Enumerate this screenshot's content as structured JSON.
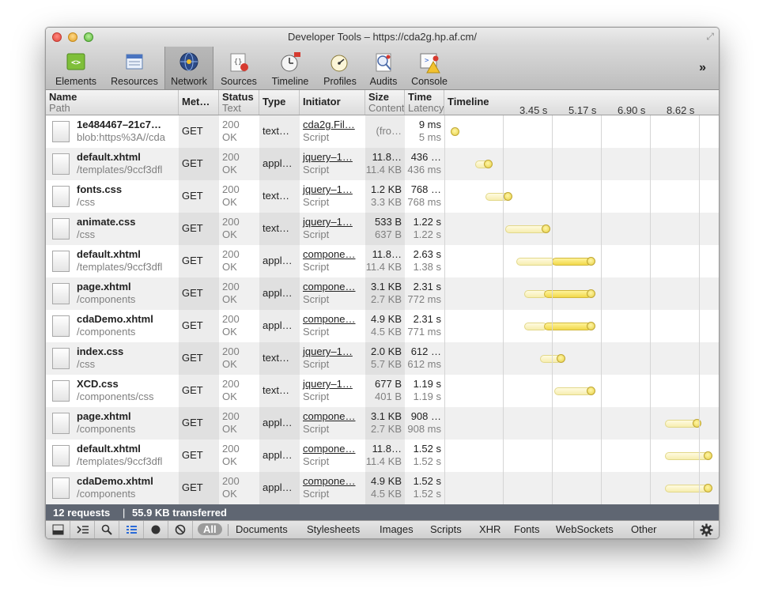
{
  "window": {
    "title": "Developer Tools – https://cda2g.hp.af.cm/"
  },
  "toolbar": {
    "items": [
      {
        "label": "Elements",
        "icon": "elements-icon"
      },
      {
        "label": "Resources",
        "icon": "resources-icon"
      },
      {
        "label": "Network",
        "icon": "network-icon",
        "selected": true
      },
      {
        "label": "Sources",
        "icon": "sources-icon"
      },
      {
        "label": "Timeline",
        "icon": "timeline-icon"
      },
      {
        "label": "Profiles",
        "icon": "profiles-icon"
      },
      {
        "label": "Audits",
        "icon": "audits-icon"
      },
      {
        "label": "Console",
        "icon": "console-icon"
      }
    ],
    "overflow": "»"
  },
  "columns": {
    "name": "Name",
    "path": "Path",
    "method": "Met…",
    "status": "Status",
    "text": "Text",
    "type": "Type",
    "initiator": "Initiator",
    "size": "Size",
    "content": "Content",
    "time": "Time",
    "latency": "Latency",
    "timeline": "Timeline",
    "ticks": [
      "3.45 s",
      "5.17 s",
      "6.90 s",
      "8.62 s"
    ]
  },
  "requests": [
    {
      "name": "1e484467–21c7…",
      "path": "blob:https%3A//cda",
      "method": "GET",
      "status": "200",
      "text": "OK",
      "type": "text…",
      "initiator": "cda2g.Fil…",
      "initiator_type": "Script",
      "size": "(fro…",
      "content": "",
      "time": "9 ms",
      "latency": "5 ms",
      "bar": {
        "start": 0.038,
        "lat_end": 0.038,
        "end": 0.038
      }
    },
    {
      "name": "default.xhtml",
      "path": "/templates/9ccf3dfl",
      "method": "GET",
      "status": "200",
      "text": "OK",
      "type": "appl…",
      "initiator": "jquery–1…",
      "initiator_type": "Script",
      "size": "11.8…",
      "content": "11.4 KB",
      "time": "436 …",
      "latency": "436 ms",
      "bar": {
        "start": 0.55,
        "lat_end": 0.8,
        "end": 0.8
      }
    },
    {
      "name": "fonts.css",
      "path": "/css",
      "method": "GET",
      "status": "200",
      "text": "OK",
      "type": "text…",
      "initiator": "jquery–1…",
      "initiator_type": "Script",
      "size": "1.2 KB",
      "content": "3.3 KB",
      "time": "768 …",
      "latency": "768 ms",
      "bar": {
        "start": 0.8,
        "lat_end": 1.25,
        "end": 1.25
      }
    },
    {
      "name": "animate.css",
      "path": "/css",
      "method": "GET",
      "status": "200",
      "text": "OK",
      "type": "text…",
      "initiator": "jquery–1…",
      "initiator_type": "Script",
      "size": "533 B",
      "content": "637 B",
      "time": "1.22 s",
      "latency": "1.22 s",
      "bar": {
        "start": 1.25,
        "lat_end": 2.1,
        "end": 2.1
      }
    },
    {
      "name": "default.xhtml",
      "path": "/templates/9ccf3dfl",
      "method": "GET",
      "status": "200",
      "text": "OK",
      "type": "appl…",
      "initiator": "compone…",
      "initiator_type": "Script",
      "size": "11.8…",
      "content": "11.4 KB",
      "time": "2.63 s",
      "latency": "1.38 s",
      "bar": {
        "start": 1.5,
        "lat_end": 2.3,
        "end": 3.13
      }
    },
    {
      "name": "page.xhtml",
      "path": "/components",
      "method": "GET",
      "status": "200",
      "text": "OK",
      "type": "appl…",
      "initiator": "compone…",
      "initiator_type": "Script",
      "size": "3.1 KB",
      "content": "2.7 KB",
      "time": "2.31 s",
      "latency": "772 ms",
      "bar": {
        "start": 1.67,
        "lat_end": 2.13,
        "end": 3.13
      }
    },
    {
      "name": "cdaDemo.xhtml",
      "path": "/components",
      "method": "GET",
      "status": "200",
      "text": "OK",
      "type": "appl…",
      "initiator": "compone…",
      "initiator_type": "Script",
      "size": "4.9 KB",
      "content": "4.5 KB",
      "time": "2.31 s",
      "latency": "771 ms",
      "bar": {
        "start": 1.67,
        "lat_end": 2.13,
        "end": 3.13
      }
    },
    {
      "name": "index.css",
      "path": "/css",
      "method": "GET",
      "status": "200",
      "text": "OK",
      "type": "text…",
      "initiator": "jquery–1…",
      "initiator_type": "Script",
      "size": "2.0 KB",
      "content": "5.7 KB",
      "time": "612 …",
      "latency": "612 ms",
      "bar": {
        "start": 2.03,
        "lat_end": 2.45,
        "end": 2.45
      }
    },
    {
      "name": "XCD.css",
      "path": "/components/css",
      "method": "GET",
      "status": "200",
      "text": "OK",
      "type": "text…",
      "initiator": "jquery–1…",
      "initiator_type": "Script",
      "size": "677 B",
      "content": "401 B",
      "time": "1.19 s",
      "latency": "1.19 s",
      "bar": {
        "start": 2.36,
        "lat_end": 3.13,
        "end": 3.13
      }
    },
    {
      "name": "page.xhtml",
      "path": "/components",
      "method": "GET",
      "status": "200",
      "text": "OK",
      "type": "appl…",
      "initiator": "compone…",
      "initiator_type": "Script",
      "size": "3.1 KB",
      "content": "2.7 KB",
      "time": "908 …",
      "latency": "908 ms",
      "bar": {
        "start": 4.88,
        "lat_end": 5.55,
        "end": 5.55
      }
    },
    {
      "name": "default.xhtml",
      "path": "/templates/9ccf3dfl",
      "method": "GET",
      "status": "200",
      "text": "OK",
      "type": "appl…",
      "initiator": "compone…",
      "initiator_type": "Script",
      "size": "11.8…",
      "content": "11.4 KB",
      "time": "1.52 s",
      "latency": "1.52 s",
      "bar": {
        "start": 4.88,
        "lat_end": 5.8,
        "end": 5.8
      }
    },
    {
      "name": "cdaDemo.xhtml",
      "path": "/components",
      "method": "GET",
      "status": "200",
      "text": "OK",
      "type": "appl…",
      "initiator": "compone…",
      "initiator_type": "Script",
      "size": "4.9 KB",
      "content": "4.5 KB",
      "time": "1.52 s",
      "latency": "1.52 s",
      "bar": {
        "start": 4.88,
        "lat_end": 5.8,
        "end": 5.8
      }
    }
  ],
  "timeline_range": {
    "min": 0,
    "max": 5.85
  },
  "status_bar": {
    "requests": "12 requests",
    "separator": "|",
    "transferred": "55.9 KB transferred"
  },
  "bottom_bar": {
    "icons": [
      "dock-icon",
      "console-prompt-icon",
      "search-icon",
      "large-rows-icon",
      "record-icon",
      "clear-icon"
    ],
    "filters": [
      "All",
      "Documents",
      "Stylesheets",
      "Images",
      "Scripts",
      "XHR",
      "Fonts",
      "WebSockets",
      "Other"
    ],
    "selected_filter": "All",
    "settings_icon": "gear-icon"
  },
  "colors": {
    "latency_bar": "#f6edb0",
    "download_bar": "#f1d84a",
    "status_bar_bg": "#5f6672",
    "row_alt": "#f0f0f0"
  }
}
